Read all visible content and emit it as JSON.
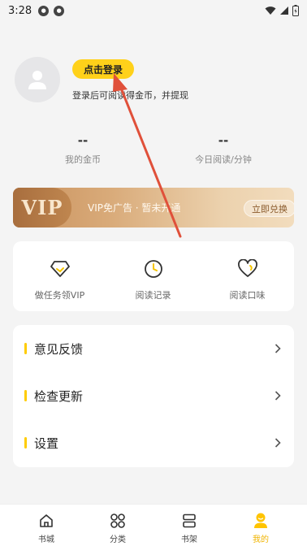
{
  "status_bar": {
    "time": "3:28",
    "notif_icons": [
      "notification-icon",
      "notification-icon"
    ],
    "right_icons": [
      "wifi-icon",
      "signal-icon",
      "battery-icon"
    ]
  },
  "profile": {
    "login_button": "点击登录",
    "login_tip": "登录后可阅读得金币，并提现",
    "avatar_icon": "user-avatar-icon"
  },
  "stats": {
    "coins": {
      "value": "--",
      "label": "我的金币"
    },
    "reading_time": {
      "value": "--",
      "label": "今日阅读/分钟"
    }
  },
  "vip_banner": {
    "logo": "VIP",
    "text": "VIP免广告 · 暂未开通",
    "button": "立即兑换"
  },
  "features": [
    {
      "label": "做任务领VIP",
      "icon": "diamond-icon"
    },
    {
      "label": "阅读记录",
      "icon": "clock-icon"
    },
    {
      "label": "阅读口味",
      "icon": "heart-icon"
    }
  ],
  "menu": [
    {
      "label": "意见反馈"
    },
    {
      "label": "检查更新"
    },
    {
      "label": "设置"
    }
  ],
  "tabbar": [
    {
      "label": "书城",
      "icon": "home-icon",
      "active": false
    },
    {
      "label": "分类",
      "icon": "category-icon",
      "active": false
    },
    {
      "label": "书架",
      "icon": "bookshelf-icon",
      "active": false
    },
    {
      "label": "我的",
      "icon": "profile-icon",
      "active": true
    }
  ],
  "colors": {
    "accent": "#ffd11a",
    "active_tab": "#f0b400",
    "annotation_arrow": "#e0503a"
  }
}
